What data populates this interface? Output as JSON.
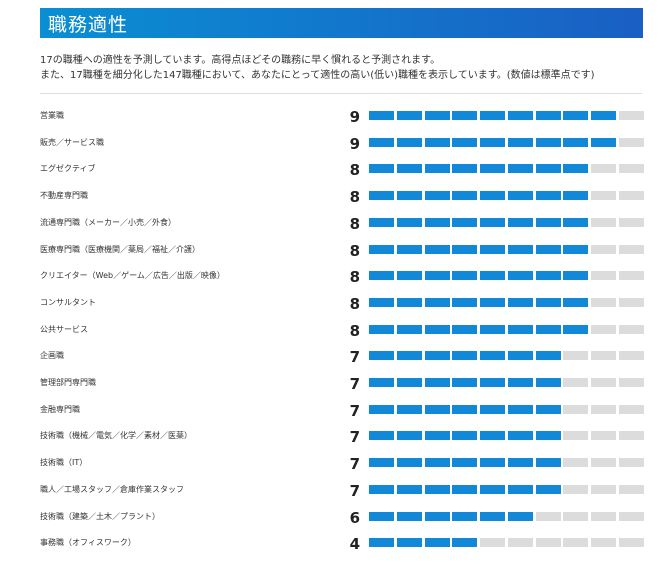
{
  "header": {
    "title": "職務適性"
  },
  "description": {
    "line1": "17の職種への適性を予測しています。高得点ほどその職務に早く慣れると予測されます。",
    "line2": "また、17職種を細分化した147職種において、あなたにとって適性の高い(低い)職種を表示しています。(数値は標準点です)"
  },
  "colors": {
    "filled": "#1188d8",
    "empty": "#dcdcdc",
    "header_start": "#0a8fd3",
    "header_end": "#1a5fc4"
  },
  "chart_data": {
    "type": "bar",
    "orientation": "horizontal",
    "max_segments": 10,
    "categories": [
      "営業職",
      "販売／サービス職",
      "エグゼクティブ",
      "不動産専門職",
      "流通専門職（メーカー／小売／外食）",
      "医療専門職（医療機関／薬局／福祉／介護）",
      "クリエイター（Web／ゲーム／広告／出版／映像）",
      "コンサルタント",
      "公共サービス",
      "企画職",
      "管理部門専門職",
      "金融専門職",
      "技術職（機械／電気／化学／素材／医薬）",
      "技術職（IT）",
      "職人／工場スタッフ／倉庫作業スタッフ",
      "技術職（建築／土木／プラント）",
      "事務職（オフィスワーク）"
    ],
    "values": [
      9,
      9,
      8,
      8,
      8,
      8,
      8,
      8,
      8,
      7,
      7,
      7,
      7,
      7,
      7,
      6,
      4
    ],
    "xlim": [
      0,
      10
    ]
  }
}
